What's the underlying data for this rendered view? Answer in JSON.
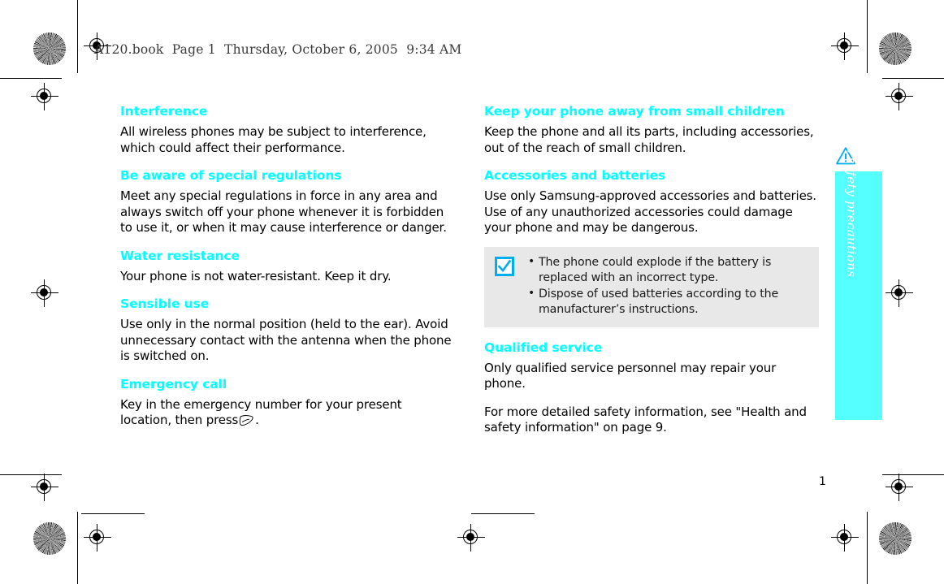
{
  "header": {
    "slug": "A120.book  Page 1  Thursday, October 6, 2005  9:34 AM"
  },
  "side_tab": {
    "label": "Important safety precautions",
    "background_color": "#55FFFF",
    "text_color": "#FFFFFF",
    "warning_icon": "warning-triangle-icon"
  },
  "colors": {
    "heading": "#00FFFF",
    "note_background": "#E8E8E8",
    "note_icon": "#00AEEF",
    "body_text": "#000000"
  },
  "left_column": {
    "sections": [
      {
        "heading": "Interference",
        "paragraphs": [
          "All wireless phones may be subject to interference, which could affect their performance."
        ]
      },
      {
        "heading": "Be aware of special regulations",
        "paragraphs": [
          "Meet any special regulations in force in any area and always switch off your phone whenever it is forbidden to use it, or when it may cause interference or danger."
        ]
      },
      {
        "heading": "Water resistance",
        "paragraphs": [
          "Your phone is not water-resistant. Keep it dry."
        ]
      },
      {
        "heading": "Sensible use",
        "paragraphs": [
          "Use only in the normal position (held to the ear). Avoid unnecessary contact with the antenna when the phone is switched on."
        ]
      },
      {
        "heading": "Emergency call",
        "paragraphs": [
          "Key in the emergency number for your present location, then press"
        ],
        "trailing_text": "."
      }
    ]
  },
  "right_column": {
    "sections": [
      {
        "heading": "Keep your phone away from small children",
        "paragraphs": [
          "Keep the phone and all its parts, including accessories, out of the reach of small children."
        ]
      },
      {
        "heading": "Accessories and batteries",
        "paragraphs": [
          "Use only Samsung-approved accessories and batteries. Use of any unauthorized accessories could damage your phone and may be dangerous."
        ]
      },
      {
        "heading": "Qualified service",
        "paragraphs": [
          "Only qualified service personnel may repair your phone.",
          "For more detailed safety information, see \"Health and safety information\" on page 9."
        ]
      }
    ],
    "note_box": {
      "icon": "checkbox-checked-icon",
      "items": [
        "The phone could explode if the battery is replaced with an incorrect type.",
        "Dispose of used batteries according to the manufacturer’s instructions."
      ]
    }
  },
  "footer": {
    "page_number": "1"
  }
}
